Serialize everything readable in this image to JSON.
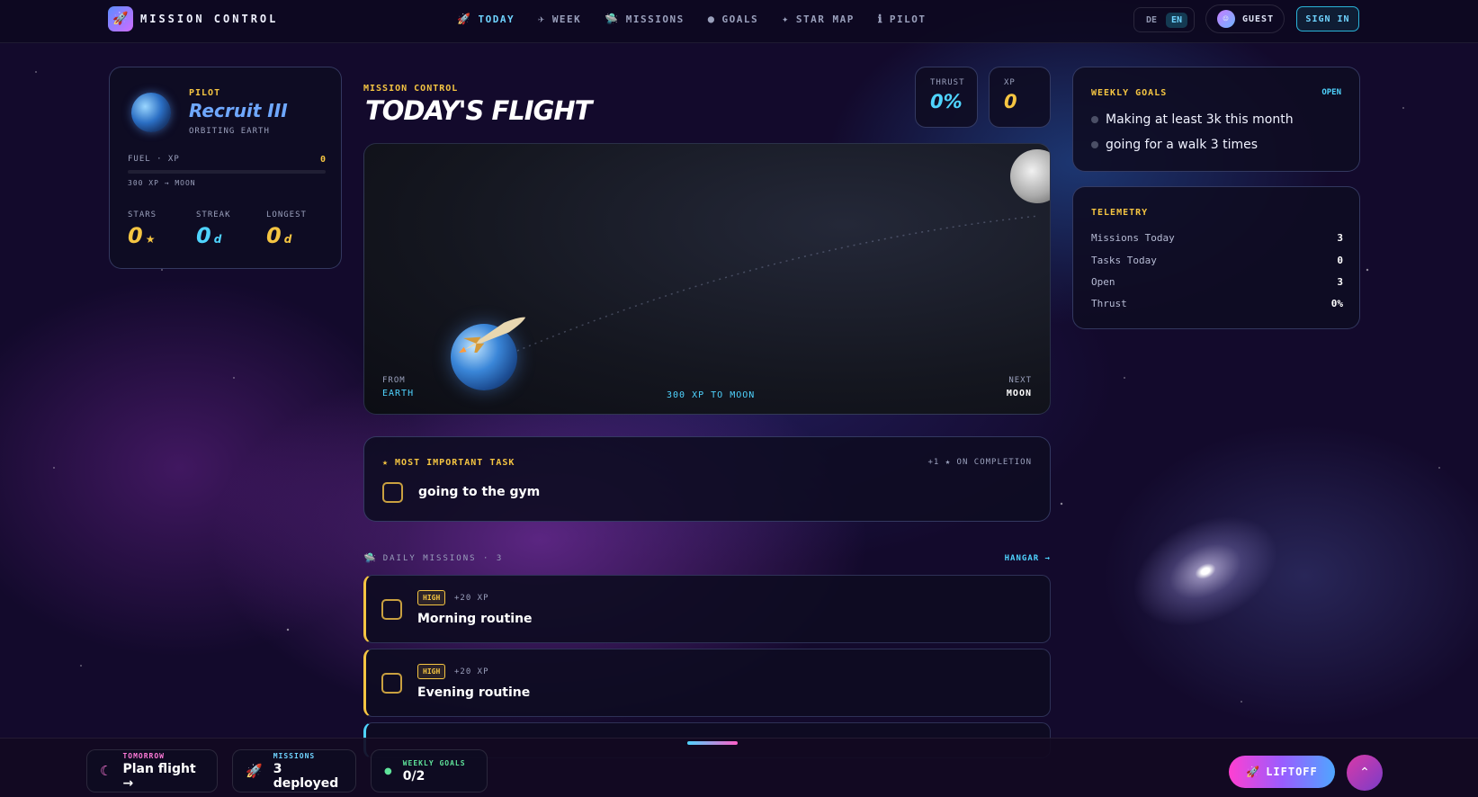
{
  "brand": {
    "name": "MISSION CONTROL",
    "logo_icon": "🚀"
  },
  "nav": [
    {
      "label": "TODAY",
      "icon": "🚀",
      "active": true
    },
    {
      "label": "WEEK",
      "icon": "✈"
    },
    {
      "label": "MISSIONS",
      "icon": "🛸"
    },
    {
      "label": "GOALS",
      "icon": "●"
    },
    {
      "label": "STAR MAP",
      "icon": "✦"
    },
    {
      "label": "PILOT",
      "icon": "ℹ"
    }
  ],
  "lang": {
    "de": "DE",
    "en": "EN",
    "active": "EN"
  },
  "user": {
    "label": "GUEST",
    "signin": "SIGN IN"
  },
  "pilot": {
    "role": "PILOT",
    "name": "Recruit III",
    "orbit": "ORBITING EARTH",
    "fuel_label": "FUEL · XP",
    "fuel_value": "0",
    "fuel_progress": 0,
    "to_moon": "300 XP → MOON",
    "stats": [
      {
        "label": "STARS",
        "value": "0",
        "unit": "★"
      },
      {
        "label": "STREAK",
        "value": "0",
        "unit": "d"
      },
      {
        "label": "LONGEST",
        "value": "0",
        "unit": "d"
      }
    ]
  },
  "flight": {
    "kicker": "MISSION CONTROL",
    "title": "TODAY'S FLIGHT",
    "thrust_label": "THRUST",
    "thrust_value": "0%",
    "xp_label": "XP",
    "xp_value": "0",
    "from_label": "FROM",
    "from_value": "EARTH",
    "middle": "300 XP TO MOON",
    "next_label": "NEXT",
    "next_value": "MOON"
  },
  "mit": {
    "header": "★ MOST IMPORTANT TASK",
    "bonus": "+1 ★ ON COMPLETION",
    "task": "going to the gym"
  },
  "daily": {
    "icon": "🛸",
    "title": "DAILY MISSIONS · 3",
    "hangar": "HANGAR →",
    "missions": [
      {
        "priority": "HIGH",
        "xp": "+20 XP",
        "title": "Morning routine"
      },
      {
        "priority": "HIGH",
        "xp": "+20 XP",
        "title": "Evening routine"
      }
    ]
  },
  "goals": {
    "header": "WEEKLY GOALS",
    "open": "OPEN",
    "items": [
      "Making at least 3k this month",
      "going for a walk 3 times"
    ]
  },
  "telemetry": {
    "header": "TELEMETRY",
    "rows": [
      {
        "label": "Missions Today",
        "value": "3"
      },
      {
        "label": "Tasks Today",
        "value": "0"
      },
      {
        "label": "Open",
        "value": "3"
      },
      {
        "label": "Thrust",
        "value": "0%"
      }
    ]
  },
  "bottom": {
    "chips": [
      {
        "icon": "☾",
        "label": "TOMORROW",
        "value": "Plan flight →",
        "color": "#ff7ad9"
      },
      {
        "icon": "🚀",
        "label": "MISSIONS",
        "value": "3 deployed",
        "color": "#6fd3ff"
      },
      {
        "icon": "●",
        "label": "WEEKLY GOALS",
        "value": "0/2",
        "color": "#5fe39a"
      }
    ],
    "liftoff": "LIFTOFF",
    "liftoff_icon": "🚀",
    "up_icon": "⌃"
  }
}
